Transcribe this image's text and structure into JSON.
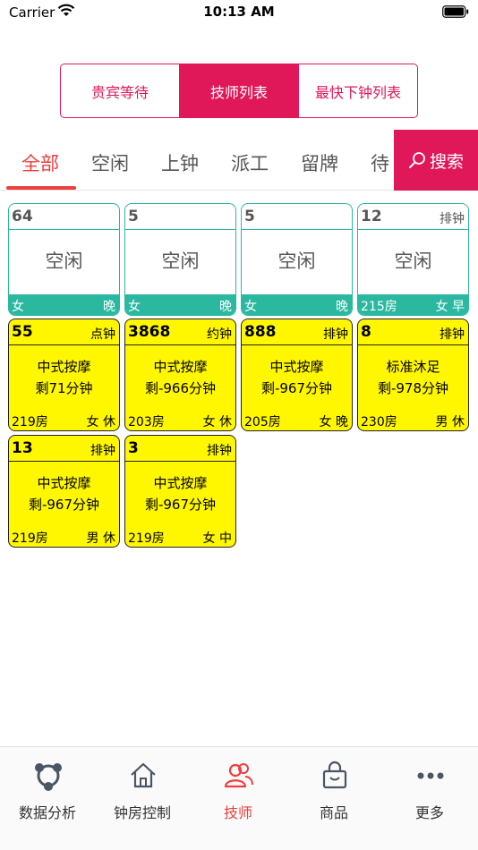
{
  "status_bar": {
    "carrier": "Carrier",
    "time": "10:13 AM"
  },
  "segment": {
    "items": [
      "贵宾等待",
      "技师列表",
      "最快下钟列表"
    ],
    "active_index": 1
  },
  "filter_tabs": {
    "items": [
      "全部",
      "空闲",
      "上钟",
      "派工",
      "留牌",
      "待"
    ],
    "active_index": 0
  },
  "search": {
    "label": "搜索"
  },
  "cards": [
    {
      "status": "idle",
      "number": "64",
      "tag": "",
      "center": "空闲",
      "room": "女",
      "right": "晚"
    },
    {
      "status": "idle",
      "number": "5",
      "tag": "",
      "center": "空闲",
      "room": "女",
      "right": "晚"
    },
    {
      "status": "idle",
      "number": "5",
      "tag": "",
      "center": "空闲",
      "room": "女",
      "right": "晚"
    },
    {
      "status": "idle",
      "number": "12",
      "tag": "排钟",
      "center": "空闲",
      "room": "215房",
      "right": "女 早"
    },
    {
      "status": "busy",
      "number": "55",
      "tag": "点钟",
      "service": "中式按摩",
      "remain": "剩71分钟",
      "room": "219房",
      "right": "女 休"
    },
    {
      "status": "busy",
      "number": "3868",
      "tag": "约钟",
      "service": "中式按摩",
      "remain": "剩-966分钟",
      "room": "203房",
      "right": "女 休"
    },
    {
      "status": "busy",
      "number": "888",
      "tag": "排钟",
      "service": "中式按摩",
      "remain": "剩-967分钟",
      "room": "205房",
      "right": "女 晚"
    },
    {
      "status": "busy",
      "number": "8",
      "tag": "排钟",
      "service": "标准沐足",
      "remain": "剩-978分钟",
      "room": "230房",
      "right": "男 休"
    },
    {
      "status": "busy",
      "number": "13",
      "tag": "排钟",
      "service": "中式按摩",
      "remain": "剩-967分钟",
      "room": "219房",
      "right": "男 休"
    },
    {
      "status": "busy",
      "number": "3",
      "tag": "排钟",
      "service": "中式按摩",
      "remain": "剩-967分钟",
      "room": "219房",
      "right": "女 中"
    }
  ],
  "tab_bar": {
    "items": [
      {
        "label": "数据分析",
        "icon": "analytics-icon"
      },
      {
        "label": "钟房控制",
        "icon": "home-icon"
      },
      {
        "label": "技师",
        "icon": "people-icon"
      },
      {
        "label": "商品",
        "icon": "bag-icon"
      },
      {
        "label": "更多",
        "icon": "more-icon"
      }
    ],
    "active_index": 2
  },
  "colors": {
    "accent": "#e0185a",
    "tab_active": "#ef3e3e",
    "idle": "#2bb8a0",
    "busy": "#fff700"
  }
}
